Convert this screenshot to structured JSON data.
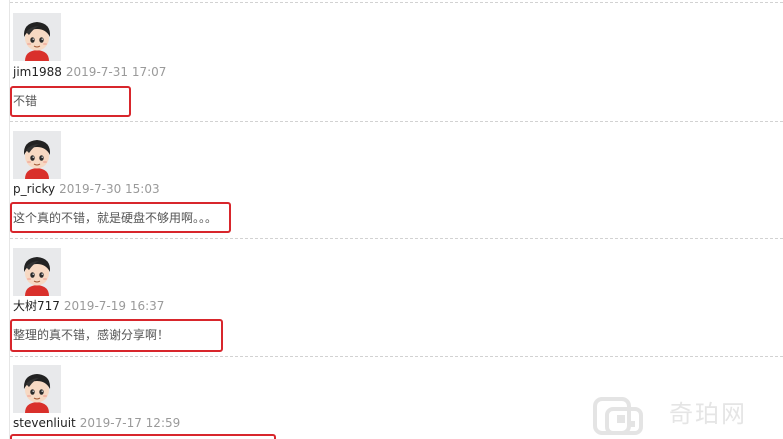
{
  "comments": [
    {
      "username": "jim1988",
      "timestamp": "2019-7-31 17:07",
      "text": "不错"
    },
    {
      "username": "p_ricky",
      "timestamp": "2019-7-30 15:03",
      "text": "这个真的不错，就是硬盘不够用啊。。。"
    },
    {
      "username": "大树717",
      "timestamp": "2019-7-19 16:37",
      "text": "整理的真不错，感谢分享啊！"
    },
    {
      "username": "stevenliuit",
      "timestamp": "2019-7-17 12:59",
      "text": ""
    }
  ],
  "avatar_icon": "cartoon-boy-avatar-icon",
  "highlight_color": "#d8262c",
  "watermark": {
    "text": "奇珀网"
  }
}
